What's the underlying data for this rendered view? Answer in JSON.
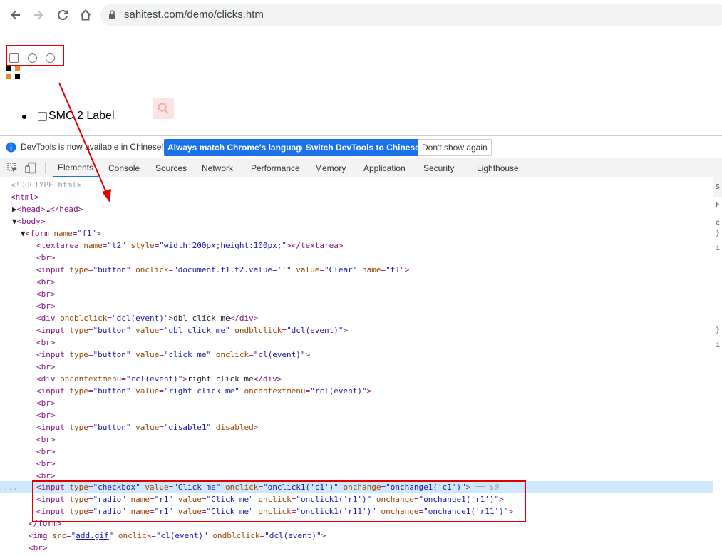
{
  "browser": {
    "url": "sahitest.com/demo/clicks.htm"
  },
  "page": {
    "list_item_label": "SMC 2 Label"
  },
  "infobar": {
    "message": "DevTools is now available in Chinese!",
    "match_language_label": "Always match Chrome's language",
    "switch_label": "Switch DevTools to Chinese",
    "dont_show_label": "Don't show again"
  },
  "devtools_tabs": [
    "Elements",
    "Console",
    "Sources",
    "Network",
    "Performance",
    "Memory",
    "Application",
    "Security",
    "Lighthouse"
  ],
  "side_panel": {
    "line1": "S",
    "line2": "F",
    "line3": "e",
    "line4": "}",
    "line5": "i",
    "line6": "}",
    "line7": "i"
  },
  "dom": {
    "doctype": "<!DOCTYPE html>",
    "html": "<html>",
    "head_open": "<head>",
    "ellipsis": "…",
    "head_close": "</head>",
    "body": "<body>",
    "form_tag": "form",
    "form_attr": "name",
    "form_val": "\"f1\"",
    "textarea_open": "<textarea",
    "textarea_name_attr": "name",
    "textarea_name_val": "\"t2\"",
    "textarea_style_attr": "style",
    "textarea_style_val": "\"width:200px;height:100px;\"",
    "textarea_close": "></textarea>",
    "br": "<br>",
    "input_open": "<input",
    "type_attr": "type",
    "button_val": "\"button\"",
    "onclick_attr": "onclick",
    "clear_onclick_val": "\"document.f1.t2.value=''\"",
    "value_attr": "value",
    "clear_val": "\"Clear\"",
    "name_attr": "name",
    "t1_val": "\"t1\"",
    "close_gt": ">",
    "div_dbl_open": "<div",
    "ondblclick_attr": "ondblclick",
    "dcl_val": "\"dcl(event)\"",
    "dbl_text": "dbl click me",
    "div_close": "</div>",
    "dbl_click_val": "\"dbl click me\"",
    "click_me_val": "\"click me\"",
    "cl_val": "\"cl(event)\"",
    "oncontextmenu_attr": "oncontextmenu",
    "rcl_val": "\"rcl(event)\"",
    "right_text": "right click me",
    "right_click_val": "\"right click me\"",
    "disable1_val": "\"disable1\"",
    "disabled_attr": "disabled",
    "checkbox_val": "\"checkbox\"",
    "Click_me_val": "\"Click me\"",
    "c1_onclick": "\"onclick1('c1')\"",
    "onchange_attr": "onchange",
    "c1_onchange": "\"onchange1('c1')\"",
    "selected_marker": " == $0",
    "radio_val": "\"radio\"",
    "r1_val": "\"r1\"",
    "r1_onclick": "\"onclick1('r1')\"",
    "r1_onchange": "\"onchange1('r1')\"",
    "r11_onclick": "\"onclick1('r11')\"",
    "r11_onchange": "\"onchange1('r11')\"",
    "form_close": "</form>",
    "img_open": "<img",
    "src_attr": "src",
    "add_gif": "add.gif",
    "ellipsis_dots": "..."
  }
}
